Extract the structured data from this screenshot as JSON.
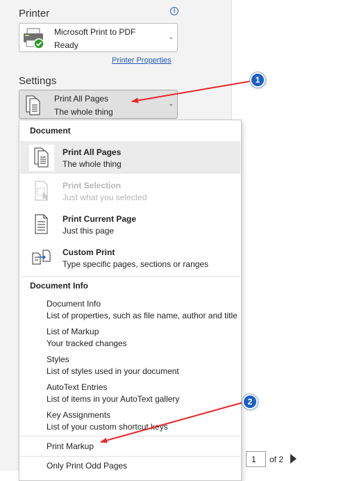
{
  "printer": {
    "heading": "Printer",
    "name": "Microsoft Print to PDF",
    "status": "Ready",
    "properties_link": "Printer Properties",
    "info_icon": "info-icon"
  },
  "settings": {
    "heading": "Settings",
    "selected_title": "Print All Pages",
    "selected_desc": "The whole thing"
  },
  "menu": {
    "document_heading": "Document",
    "items": [
      {
        "title": "Print All Pages",
        "desc": "The whole thing",
        "icon": "all-pages-icon"
      },
      {
        "title": "Print Selection",
        "desc": "Just what you selected",
        "icon": "selection-icon"
      },
      {
        "title": "Print Current Page",
        "desc": "Just this page",
        "icon": "current-page-icon"
      },
      {
        "title": "Custom Print",
        "desc": "Type specific pages, sections or ranges",
        "icon": "custom-print-icon"
      }
    ],
    "document_info_heading": "Document Info",
    "info_items": [
      {
        "title": "Document Info",
        "desc": "List of properties, such as file name, author and title"
      },
      {
        "title": "List of Markup",
        "desc": "Your tracked changes"
      },
      {
        "title": "Styles",
        "desc": "List of styles used in your document"
      },
      {
        "title": "AutoText Entries",
        "desc": "List of items in your AutoText gallery"
      },
      {
        "title": "Key Assignments",
        "desc": "List of your custom shortcut keys"
      }
    ],
    "print_markup": "Print Markup",
    "odd_pages": "Only Print Odd Pages"
  },
  "page_nav": {
    "current": "1",
    "of_total": "of 2"
  },
  "annotations": [
    {
      "label": "1"
    },
    {
      "label": "2"
    }
  ],
  "colors": {
    "accent": "#1b5fc4",
    "arrow": "#e8262a",
    "link": "#1e58b5",
    "selected_bg": "#ebebeb"
  }
}
